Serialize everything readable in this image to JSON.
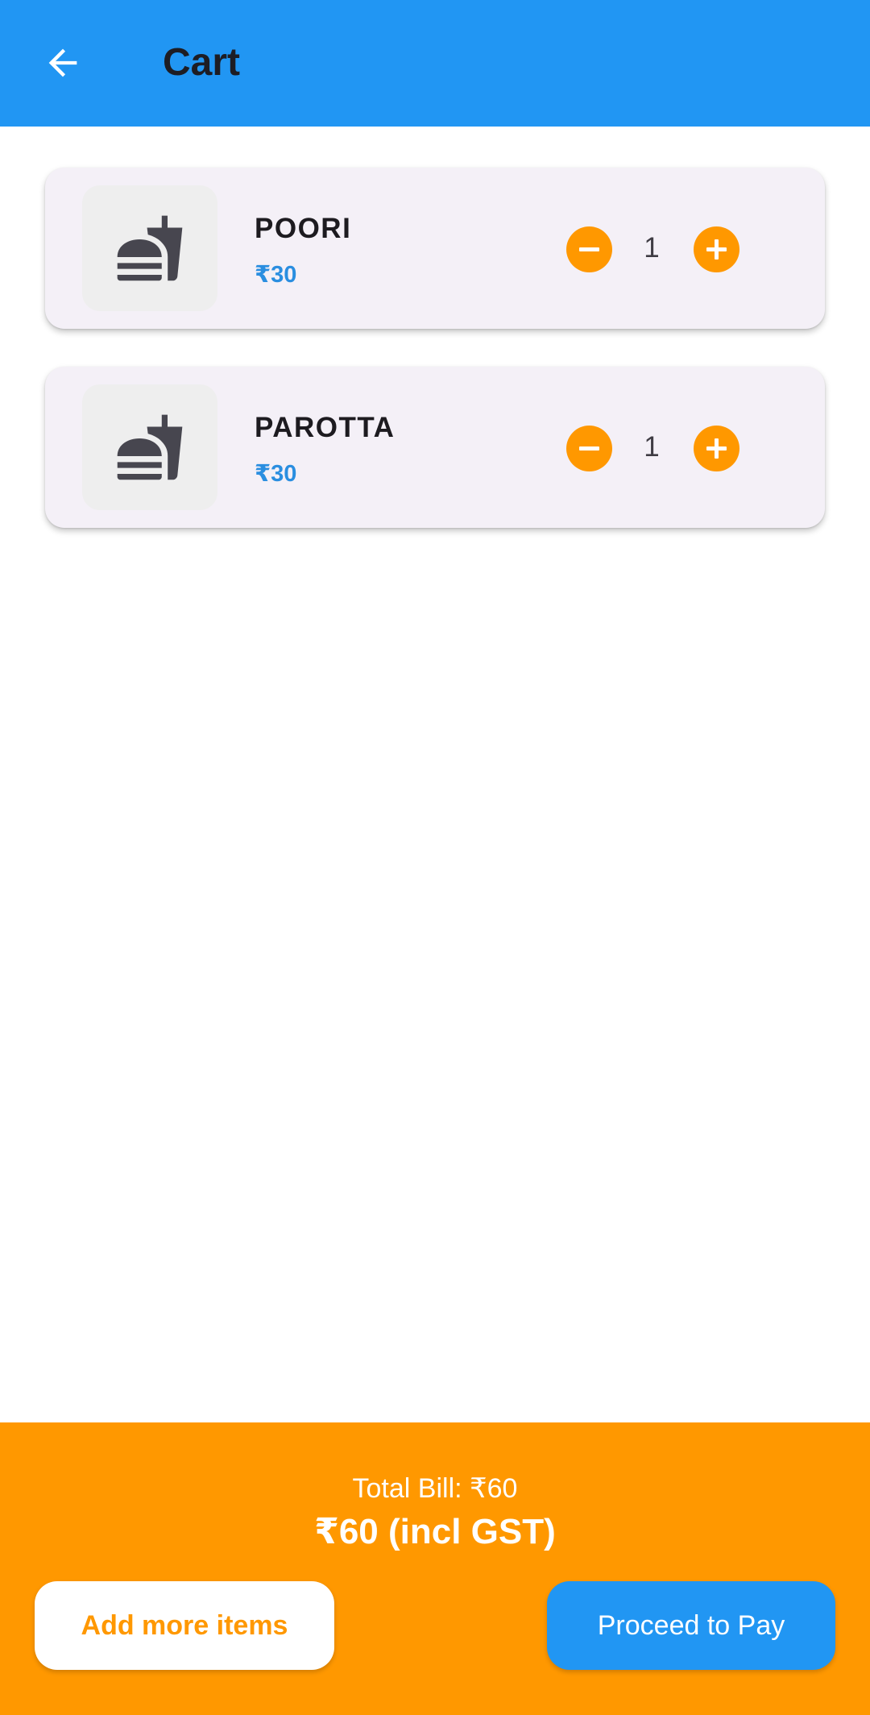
{
  "header": {
    "title": "Cart",
    "back_icon": "arrow-back-icon"
  },
  "cart": {
    "items": [
      {
        "name": "POORI",
        "price": "₹30",
        "quantity": "1",
        "icon": "fastfood-icon"
      },
      {
        "name": "PAROTTA",
        "price": "₹30",
        "quantity": "1",
        "icon": "fastfood-icon"
      }
    ]
  },
  "summary": {
    "total_label": "Total Bill: ₹60",
    "total_amount": "₹60 (incl GST)",
    "add_more_label": "Add more items",
    "proceed_label": "Proceed to Pay"
  },
  "colors": {
    "app_bar": "#2196F3",
    "accent": "#FF9800",
    "price_text": "#2a8ee0",
    "card_bg": "#f4f0f7"
  }
}
